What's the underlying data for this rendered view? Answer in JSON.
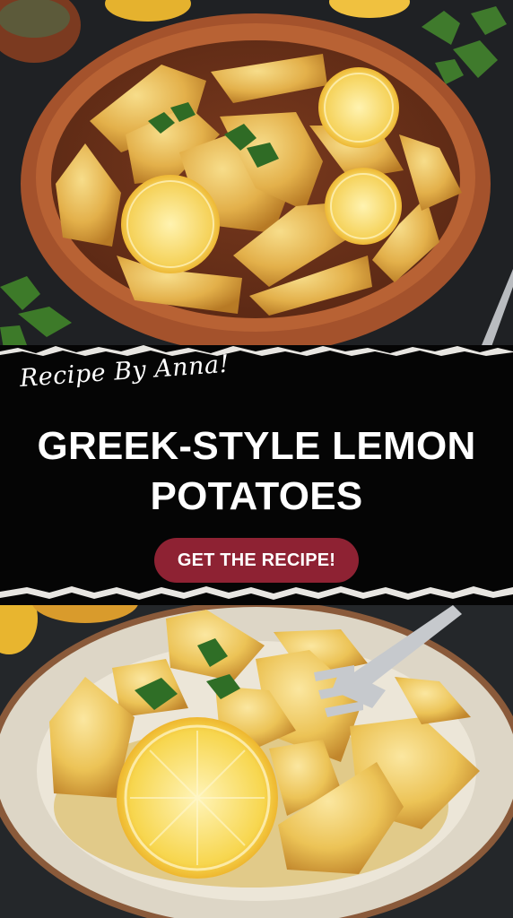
{
  "banner": {
    "credit": "Recipe By Anna!",
    "title_line1": "GREEK-STYLE LEMON",
    "title_line2": "POTATOES",
    "cta_label": "GET THE RECIPE!"
  },
  "photos": {
    "top": "roasted-lemon-potatoes-in-clay-dish",
    "bottom": "lemon-potatoes-on-plate-with-fork"
  },
  "colors": {
    "banner_bg": "#050505",
    "cta_bg": "#8e2233",
    "text": "#ffffff",
    "potato": "#e8b94a",
    "lemon": "#f3c531",
    "dish": "#9a4a2a"
  }
}
